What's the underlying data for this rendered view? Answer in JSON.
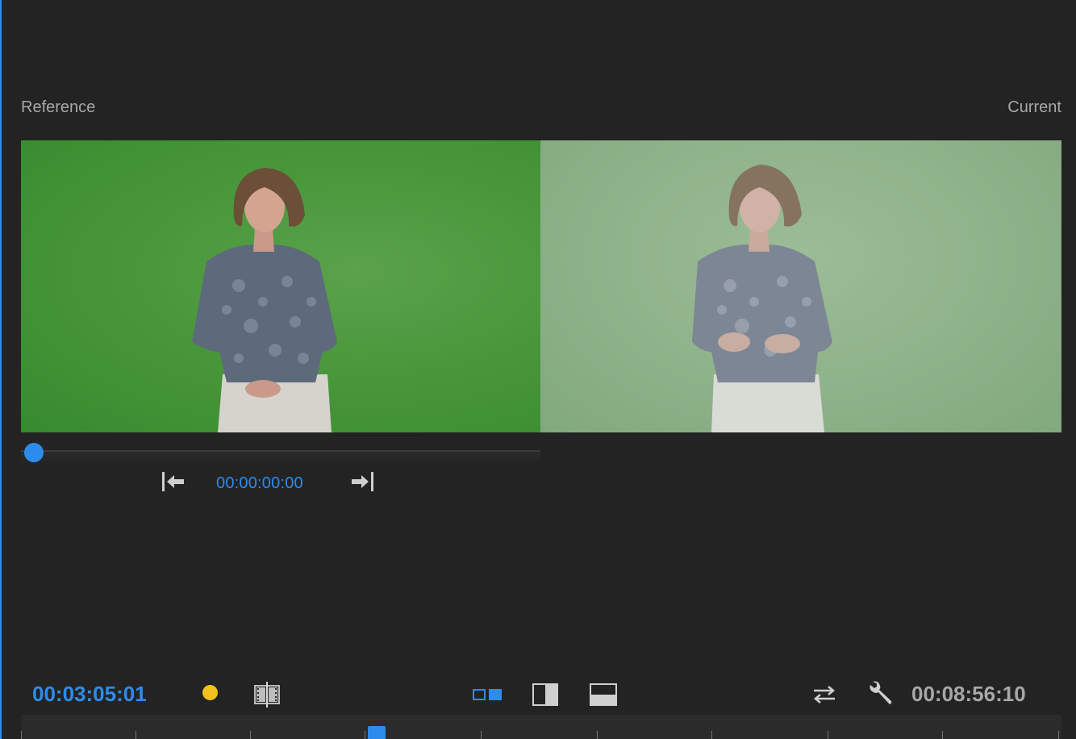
{
  "labels": {
    "reference": "Reference",
    "current": "Current"
  },
  "reference_transport": {
    "timecode": "00:00:00:00",
    "scrubber_position": 0.0,
    "go_to_in_icon": "step-to-start-icon",
    "go_to_out_icon": "step-to-end-icon"
  },
  "bottom_bar": {
    "current_timecode": "00:03:05:01",
    "total_timecode": "00:08:56:10",
    "icons": {
      "marker": "yellow-dot-icon",
      "filmstrip": "filmstrip-icon",
      "side_by_side": "side-by-side-icon",
      "vertical_split": "vertical-split-icon",
      "horizontal_split": "horizontal-split-icon",
      "swap": "swap-arrows-icon",
      "settings": "wrench-icon"
    },
    "playhead_position": 0.34
  },
  "colors": {
    "accent": "#2d8ceb",
    "background": "#232323",
    "marker": "#f1c21b",
    "text_muted": "#a8a8a8"
  }
}
